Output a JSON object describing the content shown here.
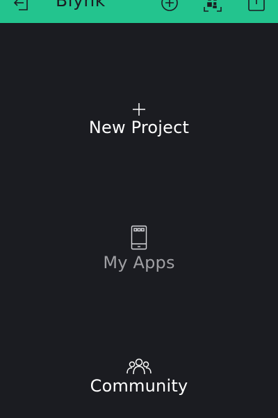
{
  "header": {
    "title": "Blynk",
    "background_color": "#23c48e",
    "icons": [
      "logout-icon",
      "add-icon",
      "qr-code-icon",
      "info-icon"
    ]
  },
  "menu": {
    "new_project": {
      "label": "New Project",
      "icon": "plus-icon"
    },
    "my_apps": {
      "label": "My Apps",
      "icon": "phone-icon"
    },
    "community": {
      "label": "Community",
      "icon": "people-icon"
    }
  },
  "colors": {
    "background": "#1b1c21",
    "accent": "#23c48e",
    "active_text": "#ffffff",
    "inactive_text": "#a0a0a4"
  }
}
